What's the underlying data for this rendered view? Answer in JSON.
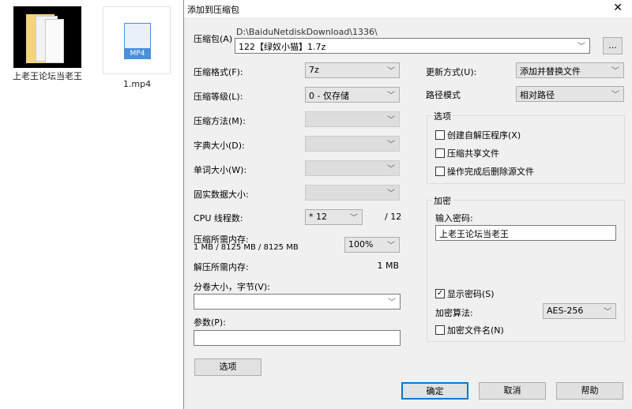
{
  "desktop": {
    "items": [
      {
        "label": "上老王论坛当老王",
        "type": "folder"
      },
      {
        "label": "1.mp4",
        "type": "video",
        "badge": "MP4"
      }
    ]
  },
  "dialog": {
    "title": "添加到压缩包",
    "close": "✕",
    "archive": {
      "label": "压缩包(A)",
      "path": "D:\\BaiduNetdiskDownload\\1336\\",
      "value": "122【绿奴小猫】1.7z",
      "browse": "..."
    },
    "format": {
      "label": "压缩格式(F):",
      "value": "7z"
    },
    "level": {
      "label": "压缩等级(L):",
      "value": "0 - 仅存储"
    },
    "method": {
      "label": "压缩方法(M):"
    },
    "dict": {
      "label": "字典大小(D):"
    },
    "word": {
      "label": "单词大小(W):"
    },
    "solid": {
      "label": "固实数据大小:"
    },
    "cpu": {
      "label": "CPU 线程数:",
      "value": "* 12",
      "max": "/ 12"
    },
    "mem": {
      "label": "压缩所需内存:",
      "detail": "1 MB / 8125 MB / 8125 MB",
      "value": "100%"
    },
    "decomp": {
      "label": "解压所需内存:",
      "value": "1 MB"
    },
    "split": {
      "label": "分卷大小，字节(V):",
      "value": ""
    },
    "params": {
      "label": "参数(P):",
      "value": ""
    },
    "options_btn": "选项",
    "update": {
      "label": "更新方式(U):",
      "value": "添加并替换文件"
    },
    "pathmode": {
      "label": "路径模式",
      "value": "相对路径"
    },
    "opts": {
      "title": "选项",
      "items": [
        {
          "label": "创建自解压程序(X)",
          "checked": false
        },
        {
          "label": "压缩共享文件",
          "checked": false
        },
        {
          "label": "操作完成后删除源文件",
          "checked": false
        }
      ]
    },
    "enc": {
      "title": "加密",
      "pw_label": "输入密码:",
      "pw": "上老王论坛当老王",
      "show": {
        "label": "显示密码(S)",
        "checked": true
      },
      "algo_label": "加密算法:",
      "algo": "AES-256",
      "encnames": {
        "label": "加密文件名(N)",
        "checked": false
      }
    },
    "ok": "确定",
    "cancel": "取消",
    "help": "帮助"
  }
}
